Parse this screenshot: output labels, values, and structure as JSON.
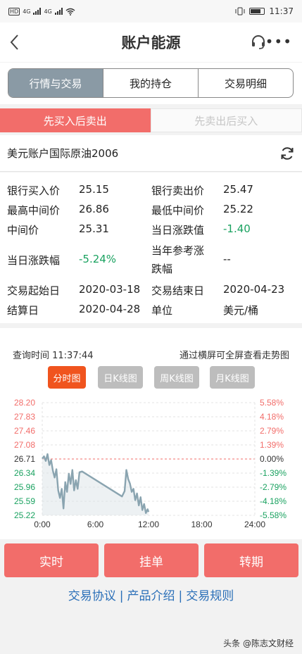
{
  "status_bar": {
    "left_label": "HD",
    "net_1": "4G",
    "net_2": "4G",
    "time": "11:37"
  },
  "nav": {
    "title": "账户能源",
    "back_icon": "chevron-left-icon",
    "service_icon": "headset-icon",
    "more_icon": "more-icon"
  },
  "tabs": [
    {
      "label": "行情与交易",
      "active": true
    },
    {
      "label": "我的持仓",
      "active": false
    },
    {
      "label": "交易明细",
      "active": false
    }
  ],
  "subtabs": [
    {
      "label": "先买入后卖出",
      "active": true
    },
    {
      "label": "先卖出后买入",
      "active": false
    }
  ],
  "product": {
    "name": "美元账户国际原油2006",
    "refresh_icon": "refresh-icon"
  },
  "info": {
    "bank_buy_label": "银行买入价",
    "bank_buy_value": "25.15",
    "bank_sell_label": "银行卖出价",
    "bank_sell_value": "25.47",
    "high_mid_label": "最高中间价",
    "high_mid_value": "26.86",
    "low_mid_label": "最低中间价",
    "low_mid_value": "25.22",
    "mid_label": "中间价",
    "mid_value": "25.31",
    "day_change_label": "当日涨跌值",
    "day_change_value": "-1.40",
    "day_pct_label": "当日涨跌幅",
    "day_pct_value": "-5.24%",
    "year_ref_label_1": "当年参考涨",
    "year_ref_label_2": "跌幅",
    "year_ref_value": "--",
    "trade_start_label": "交易起始日",
    "trade_start_value": "2020-03-18",
    "trade_end_label": "交易结束日",
    "trade_end_value": "2020-04-23",
    "settle_label": "结算日",
    "settle_value": "2020-04-28",
    "unit_label": "单位",
    "unit_value": "美元/桶"
  },
  "chart_header": {
    "query_time": "查询时间 11:37:44",
    "hint": "通过横屏可全屏查看走势图"
  },
  "chart_buttons": [
    {
      "label": "分时图",
      "active": true
    },
    {
      "label": "日K线图",
      "active": false
    },
    {
      "label": "周K线图",
      "active": false
    },
    {
      "label": "月K线图",
      "active": false
    }
  ],
  "chart_data": {
    "type": "line",
    "baseline": 26.71,
    "y_ticks": [
      "28.20",
      "27.83",
      "27.46",
      "27.08",
      "26.71",
      "26.34",
      "25.96",
      "25.59",
      "25.22"
    ],
    "y_tick_colors": [
      "#f26d6a",
      "#f26d6a",
      "#f26d6a",
      "#f26d6a",
      "#333333",
      "#1aa260",
      "#1aa260",
      "#1aa260",
      "#1aa260"
    ],
    "pct_ticks": [
      "5.58%",
      "4.18%",
      "2.79%",
      "1.39%",
      "0.00%",
      "-1.39%",
      "-2.79%",
      "-4.18%",
      "-5.58%"
    ],
    "x_ticks": [
      "0:00",
      "6:00",
      "12:00",
      "18:00",
      "24:00"
    ],
    "ylim": [
      25.22,
      28.2
    ],
    "xlim_hours": [
      0,
      24
    ],
    "line_color": "#8aa4b0",
    "series": [
      {
        "x": [
          0.0,
          0.2,
          0.4,
          0.6,
          0.8,
          1.0,
          1.2,
          1.4,
          1.6,
          1.8,
          2.0,
          2.2,
          2.4,
          2.6,
          2.8,
          3.0,
          3.2,
          3.4,
          3.6,
          3.8,
          4.0,
          4.2,
          4.5,
          9.0,
          9.3,
          9.5,
          9.7,
          9.9,
          10.1,
          10.3,
          10.5,
          10.7,
          10.9,
          11.1,
          11.3,
          11.5,
          11.7,
          11.9,
          12.0
        ],
        "y": [
          26.72,
          26.78,
          26.66,
          26.84,
          26.55,
          26.68,
          26.4,
          26.22,
          26.44,
          25.88,
          25.68,
          25.92,
          25.4,
          26.1,
          25.84,
          26.32,
          26.05,
          26.42,
          25.88,
          26.15,
          25.92,
          26.36,
          26.38,
          25.72,
          25.86,
          26.42,
          26.18,
          26.06,
          25.84,
          25.92,
          25.62,
          25.8,
          25.48,
          25.7,
          25.36,
          25.52,
          25.28,
          25.38,
          25.31
        ]
      }
    ]
  },
  "actions": [
    {
      "label": "实时"
    },
    {
      "label": "挂单"
    },
    {
      "label": "转期"
    }
  ],
  "links": [
    "交易协议",
    "产品介绍",
    "交易规则"
  ],
  "watermark": "头条 @陈志文财经"
}
